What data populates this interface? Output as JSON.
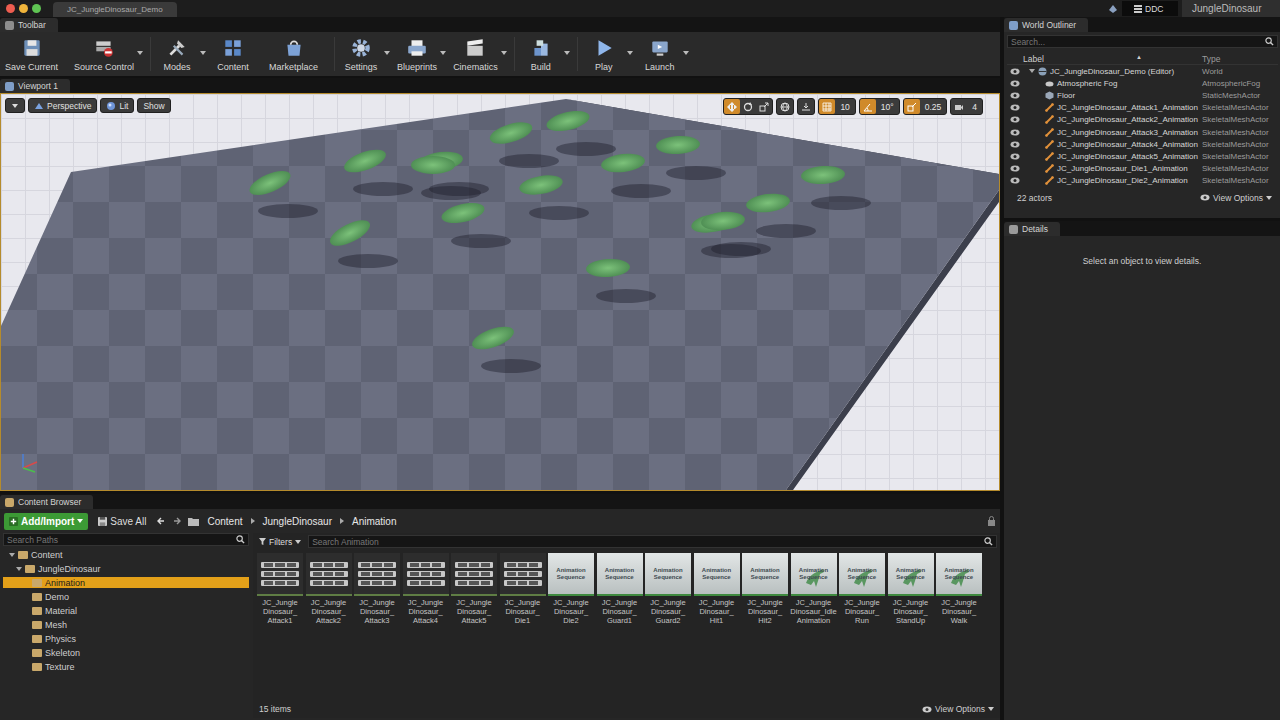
{
  "title_bar": {
    "document_tab": "JC_JungleDinosaur_Demo",
    "ddc": "DDC",
    "project": "JungleDinosaur"
  },
  "toolbar": {
    "tab": "Toolbar",
    "buttons": [
      {
        "label": "Save Current",
        "menu": false
      },
      {
        "label": "Source Control",
        "menu": true
      },
      {
        "label": "Modes",
        "menu": true
      },
      {
        "label": "Content",
        "menu": false
      },
      {
        "label": "Marketplace",
        "menu": false
      },
      {
        "label": "Settings",
        "menu": true
      },
      {
        "label": "Blueprints",
        "menu": true
      },
      {
        "label": "Cinematics",
        "menu": true
      },
      {
        "label": "Build",
        "menu": true
      },
      {
        "label": "Play",
        "menu": true
      },
      {
        "label": "Launch",
        "menu": true
      }
    ]
  },
  "viewport": {
    "tab": "Viewport 1",
    "view_mode": "Perspective",
    "lighting": "Lit",
    "show": "Show",
    "transform_tools": [
      {
        "kind": "translate",
        "selected": true
      },
      {
        "kind": "rotate",
        "selected": false
      },
      {
        "kind": "scale",
        "selected": false
      }
    ],
    "snaps": [
      {
        "kind": "grid",
        "value": "10",
        "on": true
      },
      {
        "kind": "rotation",
        "value": "10°",
        "on": true
      },
      {
        "kind": "scale",
        "value": "0.25",
        "on": true
      },
      {
        "kind": "camera",
        "value": "4",
        "on": false
      }
    ]
  },
  "content_browser": {
    "tab": "Content Browser",
    "add_import": "Add/Import",
    "save_all": "Save All",
    "breadcrumb": [
      "Content",
      "JungleDinosaur",
      "Animation"
    ],
    "path_search": {
      "placeholder": "Search Paths"
    },
    "tree": [
      {
        "label": "Content",
        "expanded": true,
        "selected": false,
        "children": [
          {
            "label": "JungleDinosaur",
            "expanded": true,
            "selected": false,
            "children": [
              {
                "label": "Animation",
                "selected": true
              },
              {
                "label": "Demo",
                "selected": false
              },
              {
                "label": "Material",
                "selected": false
              },
              {
                "label": "Mesh",
                "selected": false
              },
              {
                "label": "Physics",
                "selected": false
              },
              {
                "label": "Skeleton",
                "selected": false
              },
              {
                "label": "Texture",
                "selected": false
              }
            ]
          }
        ]
      }
    ],
    "filters": "Filters",
    "asset_search": {
      "placeholder": "Search Animation"
    },
    "assets": [
      {
        "lines": [
          "JC_Jungle",
          "Dinosaur_",
          "Attack1"
        ],
        "kind": "montage"
      },
      {
        "lines": [
          "JC_Jungle",
          "Dinosaur_",
          "Attack2"
        ],
        "kind": "montage"
      },
      {
        "lines": [
          "JC_Jungle",
          "Dinosaur_",
          "Attack3"
        ],
        "kind": "montage"
      },
      {
        "lines": [
          "JC_Jungle",
          "Dinosaur_",
          "Attack4"
        ],
        "kind": "montage"
      },
      {
        "lines": [
          "JC_Jungle",
          "Dinosaur_",
          "Attack5"
        ],
        "kind": "montage"
      },
      {
        "lines": [
          "JC_Jungle",
          "Dinosaur_",
          "Die1"
        ],
        "kind": "montage"
      },
      {
        "lines": [
          "JC_Jungle",
          "Dinosaur_",
          "Die2"
        ],
        "kind": "sequence",
        "badge": "Animation Sequence"
      },
      {
        "lines": [
          "JC_Jungle",
          "Dinosaur_",
          "Guard1"
        ],
        "kind": "sequence",
        "badge": "Animation Sequence"
      },
      {
        "lines": [
          "JC_Jungle",
          "Dinosaur_",
          "Guard2"
        ],
        "kind": "sequence",
        "badge": "Animation Sequence"
      },
      {
        "lines": [
          "JC_Jungle",
          "Dinosaur_",
          "Hit1"
        ],
        "kind": "sequence",
        "badge": "Animation Sequence"
      },
      {
        "lines": [
          "JC_Jungle",
          "Dinosaur_",
          "Hit2"
        ],
        "kind": "sequence",
        "badge": "Animation Sequence"
      },
      {
        "lines": [
          "JC_Jungle",
          "Dinosaur_Idle",
          "Animation"
        ],
        "kind": "preview",
        "badge": "Animation Sequence"
      },
      {
        "lines": [
          "JC_Jungle",
          "Dinosaur_",
          "Run"
        ],
        "kind": "preview",
        "badge": "Animation Sequence"
      },
      {
        "lines": [
          "JC_Jungle",
          "Dinosaur_",
          "StandUp"
        ],
        "kind": "preview",
        "badge": "Animation Sequence"
      },
      {
        "lines": [
          "JC_Jungle",
          "Dinosaur_",
          "Walk"
        ],
        "kind": "preview",
        "badge": "Animation Sequence"
      }
    ],
    "item_count": "15 items",
    "view_options": "View Options"
  },
  "outliner": {
    "tab": "World Outliner",
    "search": {
      "placeholder": "Search..."
    },
    "columns": [
      {
        "label": "Label",
        "sort_icon": "▲"
      },
      {
        "label": "Type"
      }
    ],
    "rows": [
      {
        "label": "JC_JungleDinosaur_Demo (Editor)",
        "type": "World",
        "kind": "world",
        "visible": true
      },
      {
        "label": "Atmospheric Fog",
        "type": "AtmosphericFog",
        "kind": "fog",
        "visible": true
      },
      {
        "label": "Floor",
        "type": "StaticMeshActor",
        "kind": "mesh",
        "visible": true
      },
      {
        "label": "JC_JungleDinosaur_Attack1_Animation",
        "type": "SkeletalMeshActor",
        "kind": "skeletal",
        "visible": true
      },
      {
        "label": "JC_JungleDinosaur_Attack2_Animation",
        "type": "SkeletalMeshActor",
        "kind": "skeletal",
        "visible": true
      },
      {
        "label": "JC_JungleDinosaur_Attack3_Animation",
        "type": "SkeletalMeshActor",
        "kind": "skeletal",
        "visible": true
      },
      {
        "label": "JC_JungleDinosaur_Attack4_Animation",
        "type": "SkeletalMeshActor",
        "kind": "skeletal",
        "visible": true
      },
      {
        "label": "JC_JungleDinosaur_Attack5_Animation",
        "type": "SkeletalMeshActor",
        "kind": "skeletal",
        "visible": true
      },
      {
        "label": "JC_JungleDinosaur_Die1_Animation",
        "type": "SkeletalMeshActor",
        "kind": "skeletal",
        "visible": true
      },
      {
        "label": "JC_JungleDinosaur_Die2_Animation",
        "type": "SkeletalMeshActor",
        "kind": "skeletal",
        "visible": true
      }
    ],
    "actor_count": "22 actors",
    "view_options": "View Options"
  },
  "details": {
    "tab": "Details",
    "empty_message": "Select an object to view details."
  }
}
